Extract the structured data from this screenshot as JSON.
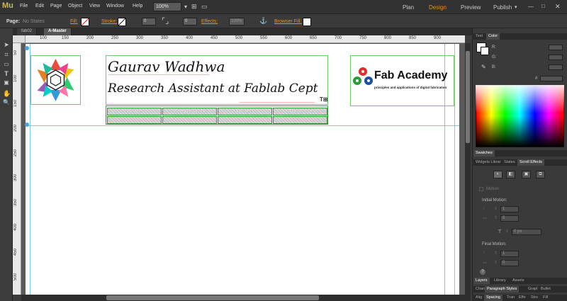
{
  "app": {
    "logo": "Mu"
  },
  "menu": [
    "File",
    "Edit",
    "Page",
    "Object",
    "View",
    "Window",
    "Help"
  ],
  "zoom": "100%",
  "workspace": {
    "plan": "Plan",
    "design": "Design",
    "preview": "Preview",
    "publish": "Publish"
  },
  "toolbar": {
    "page_label": "Page:",
    "states_value": "No States",
    "fill_label": "Fill:",
    "stroke_label": "Stroke:",
    "stroke_value": "0",
    "corner_value": "0",
    "effects_label": "Effects:",
    "effects_value": "100%",
    "browser_fill_label": "Browser Fill:"
  },
  "doc_tabs": [
    "fab02",
    "A-Master"
  ],
  "ruler_h": [
    "100",
    "150",
    "200",
    "250",
    "300",
    "350",
    "400",
    "450",
    "500",
    "550",
    "600",
    "650",
    "700",
    "750",
    "800",
    "850",
    "900"
  ],
  "ruler_v": [
    "50",
    "100",
    "150",
    "200",
    "250",
    "300",
    "350",
    "400",
    "450",
    "500",
    "550"
  ],
  "page": {
    "name": "Gaurav  Wadhwa",
    "role": "Research Assistant at  Fablab  Cept",
    "fab_title": "Fab Academy",
    "fab_subtitle": "principles and applications of digital fabrication",
    "nav": [
      "Home",
      "Weekly Work",
      "Project",
      "About me"
    ]
  },
  "panel": {
    "tabs_top": [
      "Text",
      "Color"
    ],
    "r_label": "R:",
    "g_label": "G:",
    "b_label": "B:",
    "hash": "#",
    "swatches": "Swatches",
    "tabs_mid": [
      "Widgets Librar",
      "States",
      "Scroll Effects"
    ],
    "motion": "Motion",
    "initial_motion": "Initial Motion:",
    "final_motion": "Final Motion:",
    "field_one": "1",
    "field_zero": "0",
    "px_value": "0 px",
    "tabs_layers": [
      "Layers",
      "Library",
      "Assets"
    ],
    "tabs_bottom": [
      "Chara",
      "Paragraph Styles",
      "Grapl",
      "Bullet"
    ],
    "tabs_last": [
      "Alig",
      "Spacing",
      "Tran",
      "Effe",
      "Stro",
      "Fill"
    ]
  },
  "colors": {
    "accent": "#e88a2a",
    "guide": "#7ec8e3",
    "frame": "#6cc96c"
  }
}
